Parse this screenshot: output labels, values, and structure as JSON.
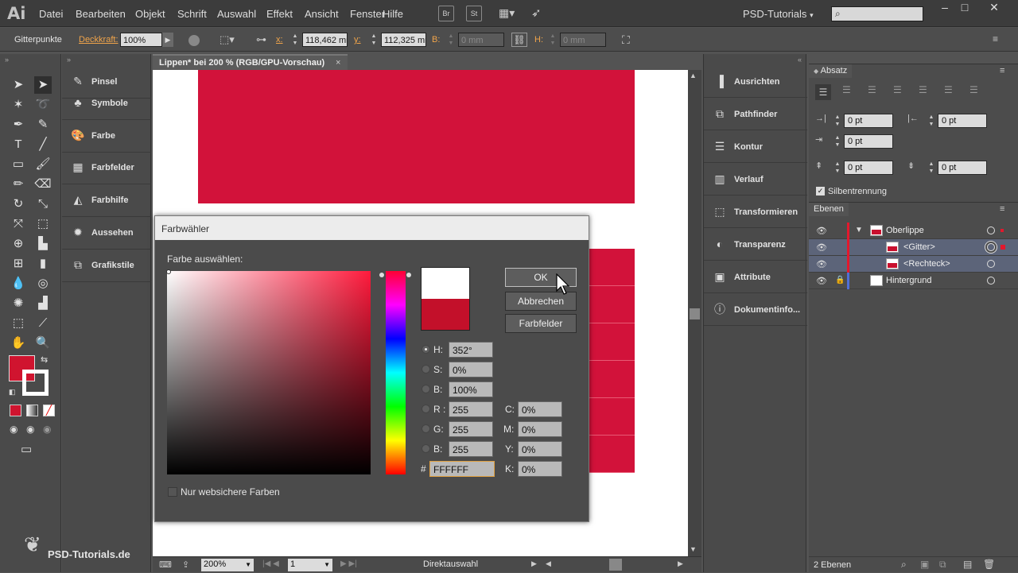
{
  "menubar": {
    "logo": "Ai",
    "menus": [
      "Datei",
      "Bearbeiten",
      "Objekt",
      "Schrift",
      "Auswahl",
      "Effekt",
      "Ansicht",
      "Fenster",
      "Hilfe"
    ],
    "bridge_label": "Br",
    "stock_label": "St",
    "workspace": "PSD-Tutorials",
    "win_min": "–",
    "win_max": "□",
    "win_close": "✕"
  },
  "controlbar": {
    "selection_label": "Gitterpunkte",
    "opacity_label": "Deckkraft:",
    "opacity_value": "100%",
    "x_label": "x:",
    "x_value": "118,462 mm",
    "y_label": "y:",
    "y_value": "112,325 mm",
    "b_label": "B:",
    "b_value": "0 mm",
    "h_label": "H:",
    "h_value": "0 mm"
  },
  "tools": {
    "fill_color": "#d0142f"
  },
  "dock1": {
    "items": [
      {
        "label": "Pinsel",
        "icon": "brush-icon"
      },
      {
        "label": "Symbole",
        "icon": "symbols-icon"
      },
      {
        "label": "Farbe",
        "icon": "palette-icon"
      },
      {
        "label": "Farbfelder",
        "icon": "swatches-icon"
      },
      {
        "label": "Farbhilfe",
        "icon": "color-guide-icon"
      },
      {
        "label": "Aussehen",
        "icon": "appearance-icon"
      },
      {
        "label": "Grafikstile",
        "icon": "graphic-styles-icon"
      }
    ]
  },
  "document": {
    "tab_title": "Lippen* bei 200 % (RGB/GPU-Vorschau)",
    "tab_close": "×",
    "artwork_color": "#d2123a"
  },
  "status": {
    "zoom": "200%",
    "page": "1",
    "tool": "Direktauswahl"
  },
  "dialog": {
    "title": "Farbwähler",
    "choose_label": "Farbe auswählen:",
    "buttons": {
      "ok": "OK",
      "cancel": "Abbrechen",
      "swatches": "Farbfelder"
    },
    "new_color": "#ffffff",
    "old_color": "#c3102a",
    "fields": {
      "H": {
        "label": "H:",
        "value": "352°"
      },
      "S": {
        "label": "S:",
        "value": "0%"
      },
      "Bv": {
        "label": "B:",
        "value": "100%"
      },
      "R": {
        "label": "R :",
        "value": "255"
      },
      "G": {
        "label": "G:",
        "value": "255"
      },
      "Bb": {
        "label": "B:",
        "value": "255"
      },
      "hex": {
        "label": "#",
        "value": "FFFFFF"
      },
      "C": {
        "label": "C:",
        "value": "0%"
      },
      "M": {
        "label": "M:",
        "value": "0%"
      },
      "Y": {
        "label": "Y:",
        "value": "0%"
      },
      "K": {
        "label": "K:",
        "value": "0%"
      }
    },
    "websafe_label": "Nur websichere Farben"
  },
  "dock2": {
    "items": [
      {
        "label": "Ausrichten",
        "icon": "align-icon"
      },
      {
        "label": "Pathfinder",
        "icon": "pathfinder-icon"
      },
      {
        "label": "Kontur",
        "icon": "stroke-icon"
      },
      {
        "label": "Verlauf",
        "icon": "gradient-icon"
      },
      {
        "label": "Transformieren",
        "icon": "transform-icon"
      },
      {
        "label": "Transparenz",
        "icon": "transparency-icon"
      },
      {
        "label": "Attribute",
        "icon": "attributes-icon"
      },
      {
        "label": "Dokumentinfo...",
        "icon": "document-info-icon"
      }
    ]
  },
  "absatz": {
    "tab": "Absatz",
    "left_indent": "0 pt",
    "right_indent": "0 pt",
    "first_line": "0 pt",
    "space_before": "0 pt",
    "space_after": "0 pt",
    "hyphenation_label": "Silbentrennung"
  },
  "ebenen": {
    "tab": "Ebenen",
    "layers": [
      {
        "name": "Oberlippe"
      },
      {
        "name": "<Gitter>"
      },
      {
        "name": "<Rechteck>"
      },
      {
        "name": "Hintergrund"
      }
    ],
    "count": "2 Ebenen"
  },
  "watermark": "PSD-Tutorials.de"
}
